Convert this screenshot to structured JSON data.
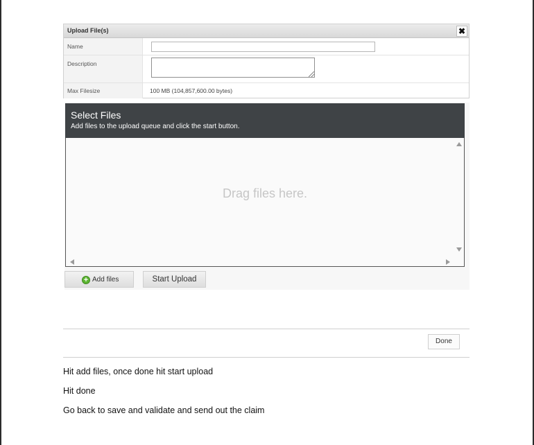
{
  "dialog": {
    "title": "Upload File(s)",
    "close_icon": "close-icon",
    "fields": {
      "name_label": "Name",
      "name_value": "",
      "description_label": "Description",
      "description_value": "",
      "max_filesize_label": "Max Filesize",
      "max_filesize_value": "100 MB (104,857,600.00 bytes)"
    }
  },
  "uploader": {
    "title": "Select Files",
    "subtitle": "Add files to the upload queue and click the start button.",
    "drop_text": "Drag files here.",
    "add_files_label": "Add files",
    "add_files_icon": "plus-circle-icon",
    "start_upload_label": "Start Upload"
  },
  "footer": {
    "done_label": "Done"
  },
  "instructions": [
    "Hit add files, once done hit start upload",
    "Hit done",
    "Go back to save and validate and send out the claim"
  ],
  "colors": {
    "header_dark": "#3f4346",
    "add_icon_green": "#5cb531"
  }
}
